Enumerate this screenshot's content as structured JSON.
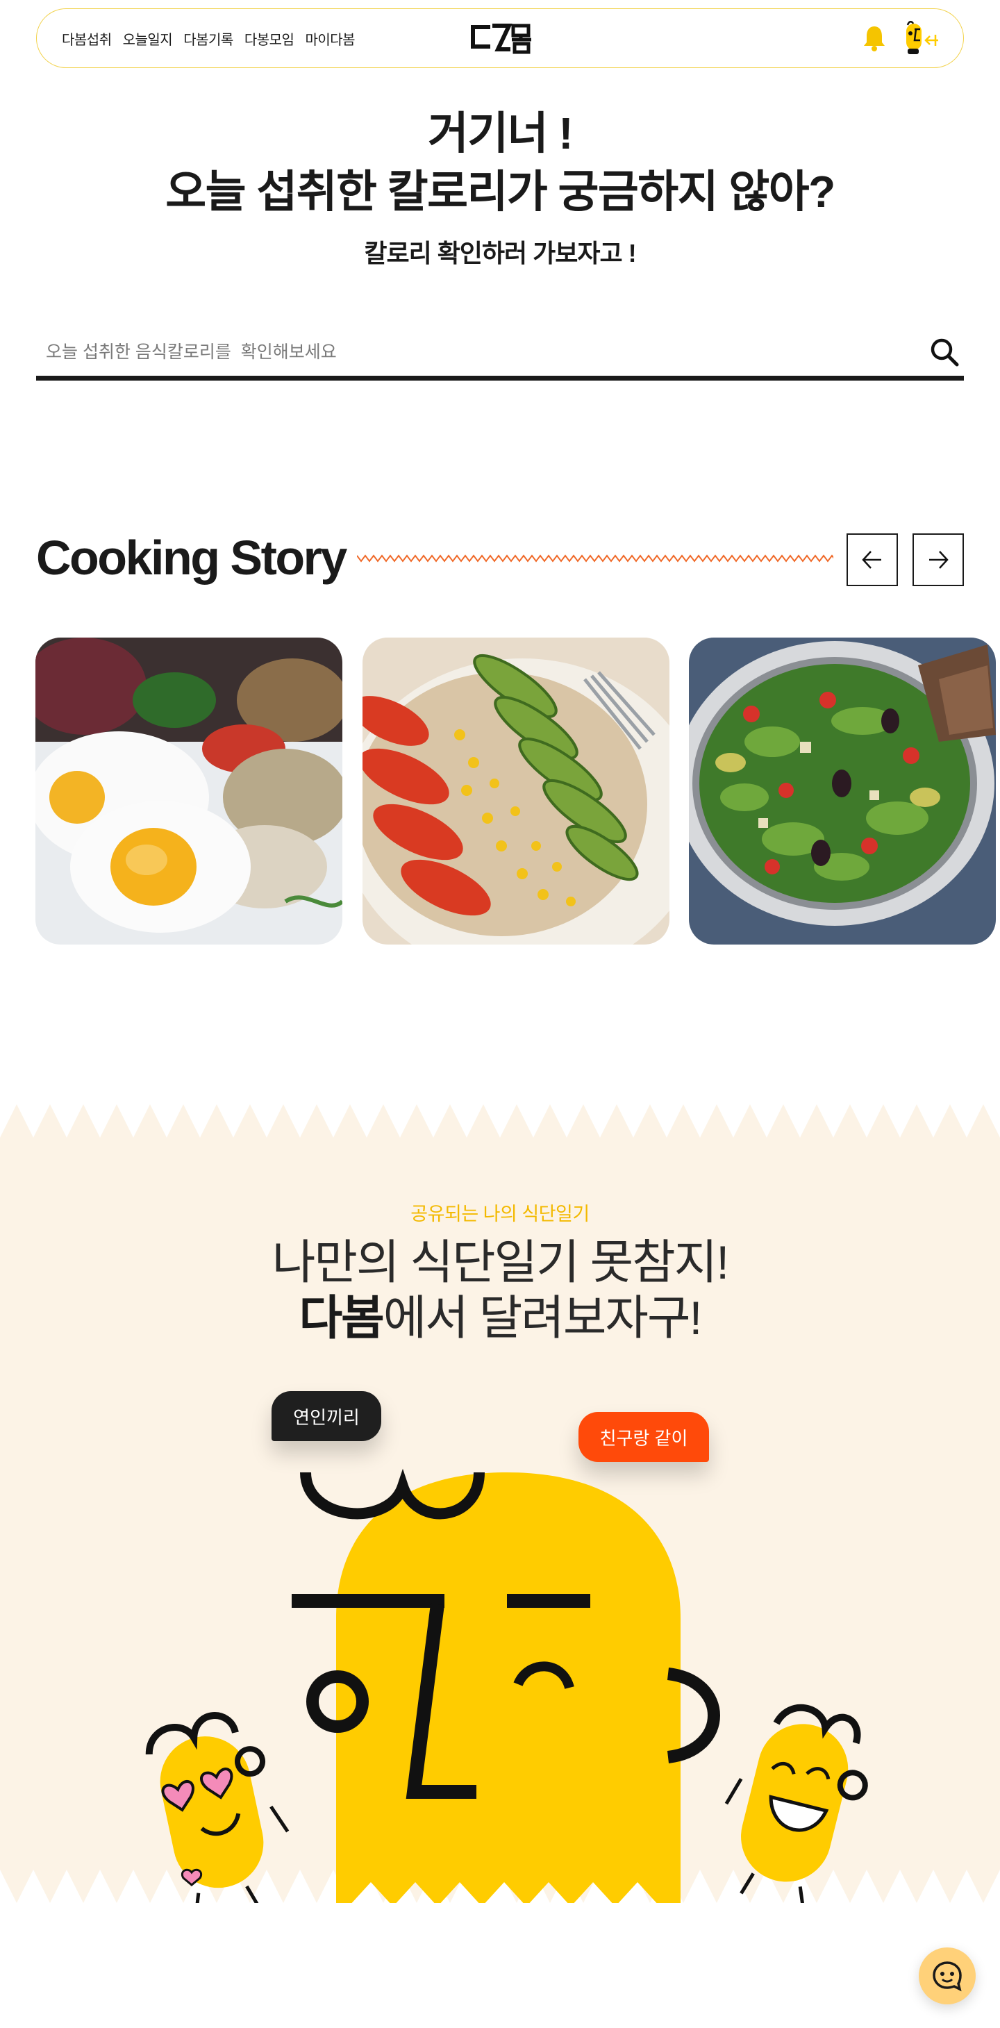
{
  "header": {
    "nav": [
      "다봄섭취",
      "오늘일지",
      "다봄기록",
      "다봉모임",
      "마이다봄"
    ],
    "logo_text": "다봄"
  },
  "hero": {
    "line1": "거기너 !",
    "line2": "오늘 섭취한 칼로리가 궁금하지 않아?",
    "subtitle": "칼로리 확인하러 가보자고 !"
  },
  "search": {
    "placeholder": "오늘 섭취한 음식칼로리를  확인해보세요"
  },
  "story": {
    "title": "Cooking Story",
    "cards": [
      "fried-eggs-vegetables",
      "tomato-avocado-corn-plate",
      "green-salad-bowl"
    ]
  },
  "diary": {
    "kicker": "공유되는 나의 식단일기",
    "line1": "나만의 식단일기 못참지!",
    "brand": "다봄",
    "line2_rest": "에서 달려보자구!",
    "bubble_couple": "연인끼리",
    "bubble_friend": "친구랑 같이"
  },
  "colors": {
    "brand_yellow": "#ffcc00",
    "accent_orange": "#ff4a0a",
    "section_bg": "#fcf3e6",
    "kicker_yellow": "#f3b900"
  }
}
